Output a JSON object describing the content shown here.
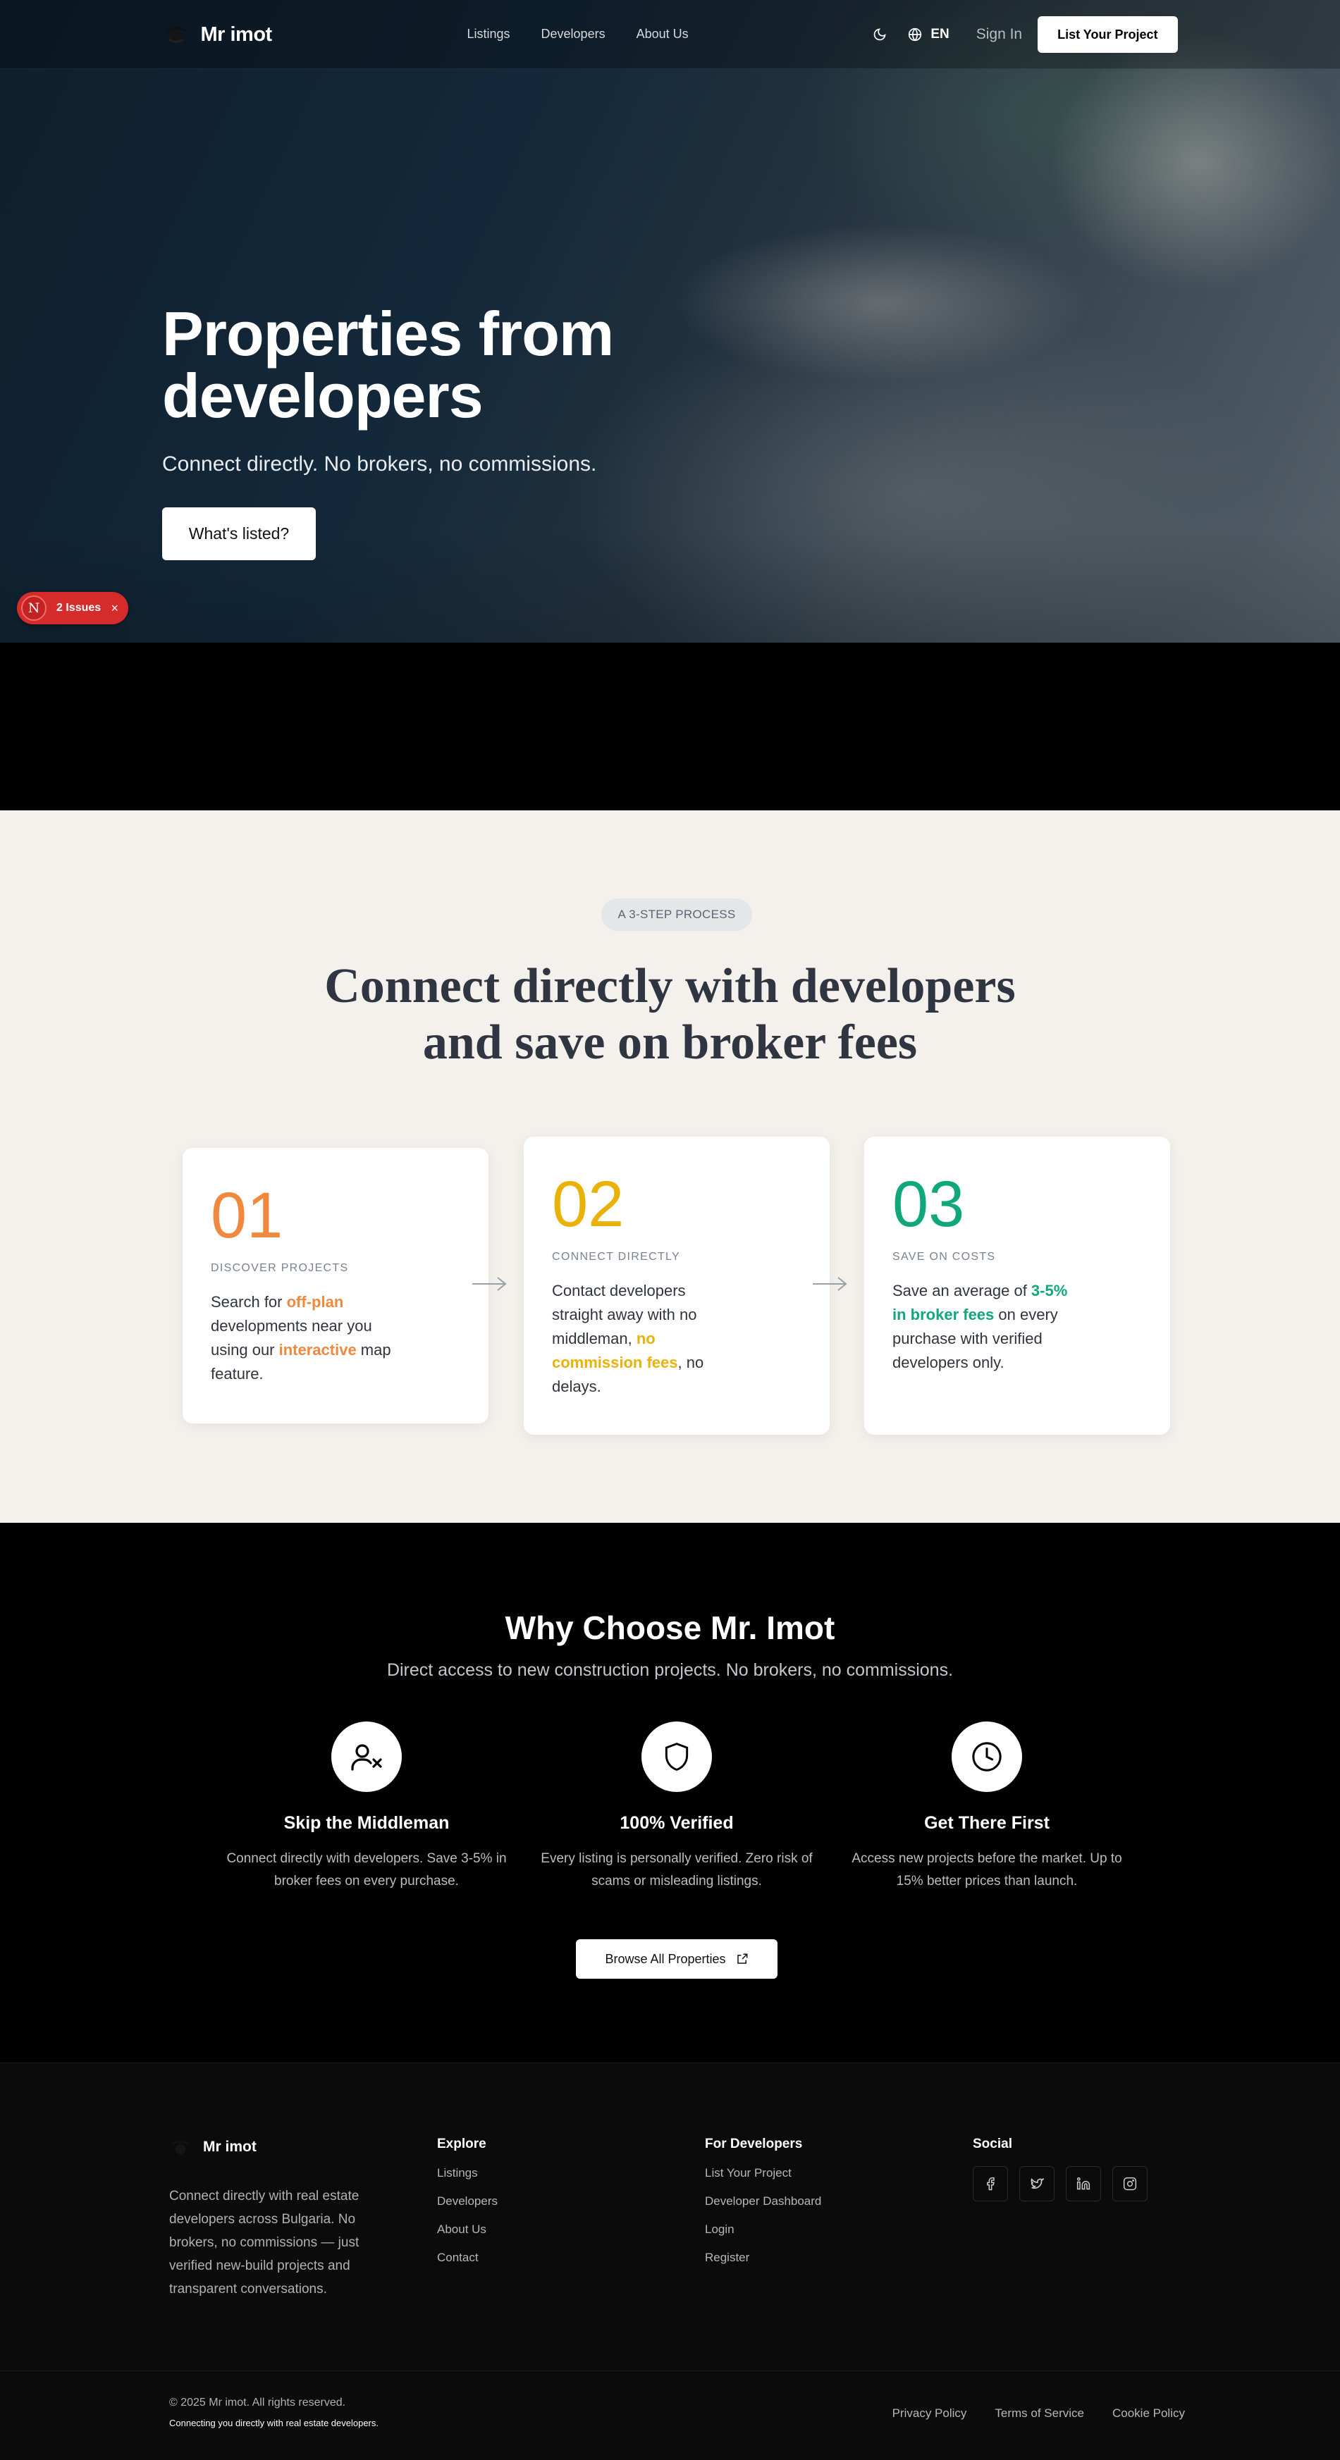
{
  "brand": {
    "name": "Mr imot"
  },
  "nav": {
    "links": [
      "Listings",
      "Developers",
      "About Us"
    ],
    "language": "EN",
    "signin": "Sign In",
    "cta": "List Your Project"
  },
  "hero": {
    "title": "Properties from developers",
    "subtitle": "Connect directly. No brokers, no commissions.",
    "button": "What's listed?"
  },
  "dev_overlay": {
    "badge": "N",
    "label": "2 Issues",
    "close": "×"
  },
  "process": {
    "pill": "A 3-STEP PROCESS",
    "title_line1": "Connect directly with developers",
    "title_line2": "and save on broker fees",
    "steps": [
      {
        "num": "01",
        "color": "#f0883e",
        "caption": "DISCOVER PROJECTS",
        "parts": [
          {
            "t": "Search for "
          },
          {
            "t": "off-plan",
            "b": true
          },
          {
            "t": " developments near you using our "
          },
          {
            "t": "interactive",
            "b": true
          },
          {
            "t": " map feature."
          }
        ]
      },
      {
        "num": "02",
        "color": "#eab208",
        "caption": "CONNECT DIRECTLY",
        "parts": [
          {
            "t": "Contact developers straight away with no middleman, "
          },
          {
            "t": "no commission fees",
            "b": true
          },
          {
            "t": ", no delays."
          }
        ]
      },
      {
        "num": "03",
        "color": "#10a87a",
        "caption": "SAVE ON COSTS",
        "parts": [
          {
            "t": "Save an average of "
          },
          {
            "t": "3-5% in broker fees",
            "b": true
          },
          {
            "t": " on every purchase with verified developers only."
          }
        ]
      }
    ]
  },
  "why": {
    "title": "Why Choose Mr. Imot",
    "subtitle": "Direct access to new construction projects. No brokers, no commissions.",
    "features": [
      {
        "icon": "user-x-icon",
        "title": "Skip the Middleman",
        "desc": "Connect directly with developers. Save 3-5% in broker fees on every purchase."
      },
      {
        "icon": "shield-icon",
        "title": "100% Verified",
        "desc": "Every listing is personally verified. Zero risk of scams or misleading listings."
      },
      {
        "icon": "clock-icon",
        "title": "Get There First",
        "desc": "Access new projects before the market. Up to 15% better prices than launch."
      }
    ],
    "button": "Browse All Properties"
  },
  "footer": {
    "brand": "Mr imot",
    "about": "Connect directly with real estate developers across Bulgaria. No brokers, no commissions — just verified new-build projects and transparent conversations.",
    "explore": {
      "title": "Explore",
      "links": [
        "Listings",
        "Developers",
        "About Us",
        "Contact"
      ]
    },
    "developers": {
      "title": "For Developers",
      "links": [
        "List Your Project",
        "Developer Dashboard",
        "Login",
        "Register"
      ]
    },
    "social": {
      "title": "Social",
      "icons": [
        "facebook-icon",
        "twitter-icon",
        "linkedin-icon",
        "instagram-icon"
      ]
    },
    "copyright": "© 2025 Mr imot. All rights reserved.",
    "tagline": "Connecting you directly with real estate developers.",
    "legal": [
      "Privacy Policy",
      "Terms of Service",
      "Cookie Policy"
    ]
  }
}
